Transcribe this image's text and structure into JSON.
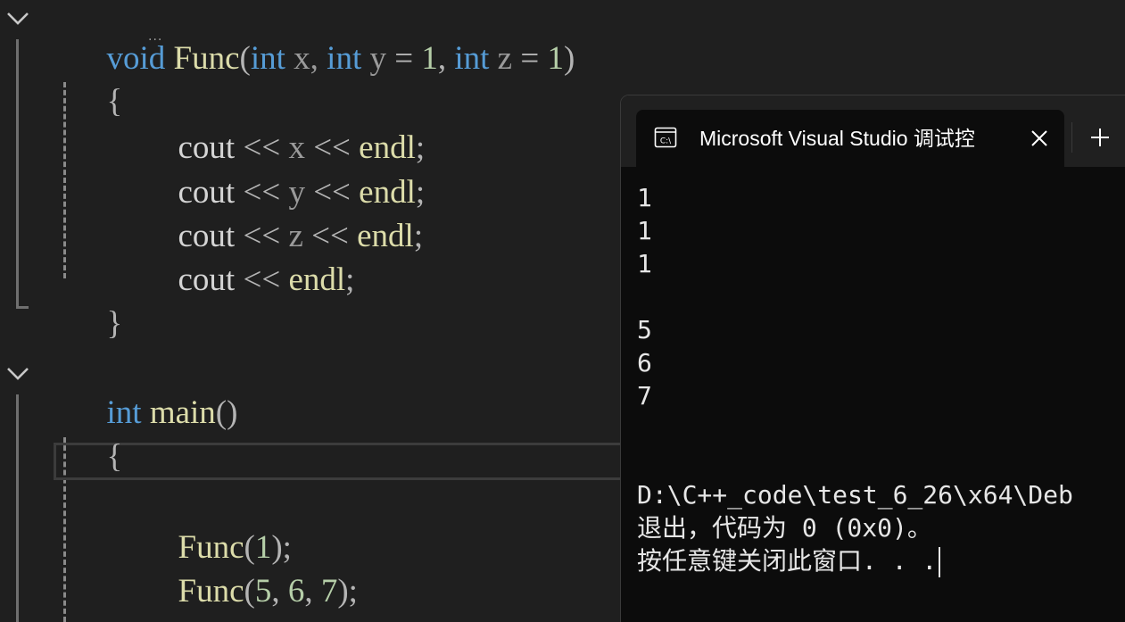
{
  "editor": {
    "func_signature": {
      "ret_type": "void",
      "name": "Func",
      "open_paren": "(",
      "p1_type": "int",
      "p1_name": " x, ",
      "p2_type": "int",
      "p2_name": " y ",
      "p2_eq": "= ",
      "p2_default": "1",
      "p2_comma": ", ",
      "p3_type": "int",
      "p3_name": " z ",
      "p3_eq": "= ",
      "p3_default": "1",
      "close_paren": ")",
      "definition_marker": "..."
    },
    "func_open_brace": "{",
    "func_body": [
      {
        "cout": "cout",
        "op1": " << ",
        "var": "x",
        "op2": " << ",
        "endl": "endl",
        "semi": ";"
      },
      {
        "cout": "cout",
        "op1": " << ",
        "var": "y",
        "op2": " << ",
        "endl": "endl",
        "semi": ";"
      },
      {
        "cout": "cout",
        "op1": " << ",
        "var": "z",
        "op2": " << ",
        "endl": "endl",
        "semi": ";"
      }
    ],
    "func_last_line": {
      "cout": "cout",
      "op1": " << ",
      "endl": "endl",
      "semi": ";"
    },
    "func_close_brace": "}",
    "main_signature": {
      "ret_type": "int",
      "name": "main",
      "parens": "()"
    },
    "main_open_brace": "{",
    "main_calls": [
      {
        "name": "Func",
        "open": "(",
        "args": [
          {
            "v": "1"
          }
        ],
        "close": ");"
      },
      {
        "name": "Func",
        "open": "(",
        "args": [
          {
            "v": "5"
          },
          {
            "v": "6"
          },
          {
            "v": "7"
          }
        ],
        "close": ");"
      }
    ],
    "arg_separator": ", "
  },
  "terminal": {
    "tab_title": "Microsoft Visual Studio 调试控",
    "tab_icon": "console-icon",
    "close_icon": "close-icon",
    "new_tab_icon": "plus-icon",
    "output_lines": [
      "1",
      "1",
      "1",
      "",
      "5",
      "6",
      "7",
      "",
      ""
    ],
    "exit_path_line": "D:\\C++_code\\test_6_26\\x64\\Deb",
    "exit_code_line": "退出，代码为 0 (0x0)。",
    "press_key_line": "按任意键关闭此窗口. . ."
  },
  "colors": {
    "background": "#1f1f1f",
    "keyword": "#569cd6",
    "function": "#dcdcaa",
    "number": "#b5cea8",
    "variable": "#9a9a9a",
    "terminal_bg": "#0c0c0c",
    "terminal_tabbar": "#202020"
  }
}
